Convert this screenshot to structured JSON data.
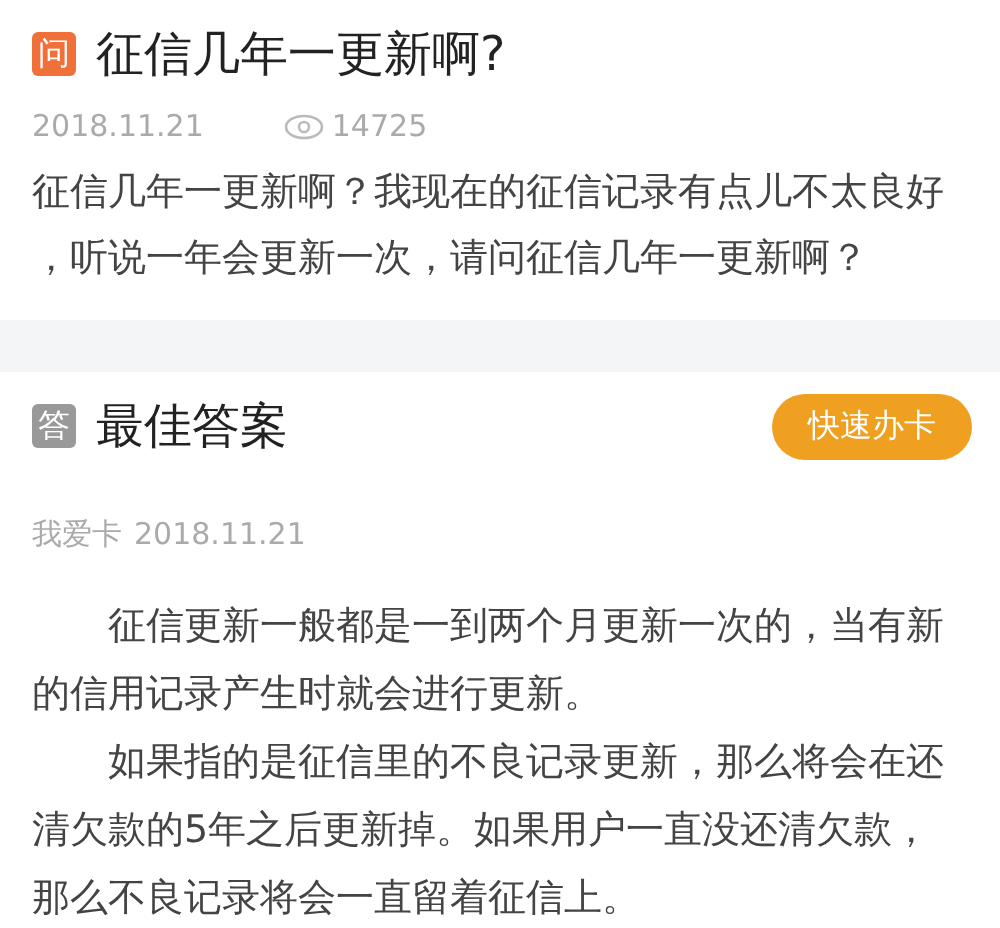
{
  "question": {
    "badge": "问",
    "title": "征信几年一更新啊?",
    "date": "2018.11.21",
    "views": "14725",
    "body": "征信几年一更新啊？我现在的征信记录有点儿不太良好，听说一年会更新一次，请问征信几年一更新啊？"
  },
  "answer": {
    "badge": "答",
    "title": "最佳答案",
    "button": "快速办卡",
    "author": "我爱卡",
    "date": "2018.11.21",
    "paragraphs": [
      "征信更新一般都是一到两个月更新一次的，当有新的信用记录产生时就会进行更新。",
      "如果指的是征信里的不良记录更新，那么将会在还清欠款的5年之后更新掉。如果用户一直没还清欠款，那么不良记录将会一直留着征信上。"
    ]
  }
}
